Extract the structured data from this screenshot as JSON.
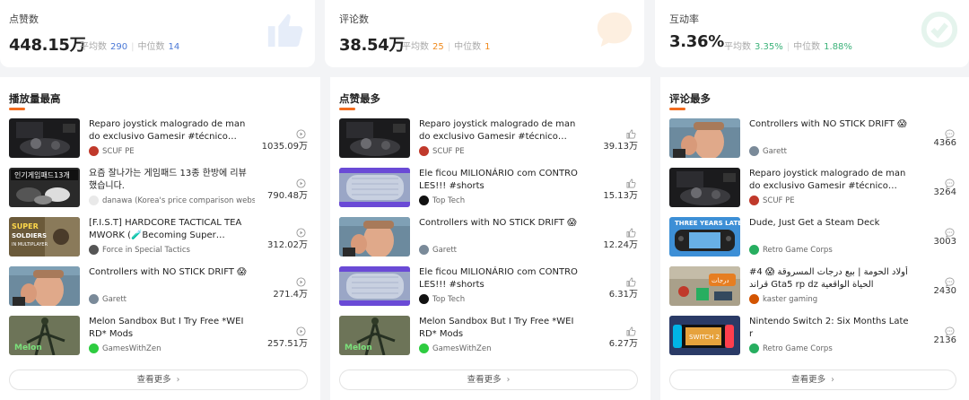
{
  "stats": [
    {
      "title": "点赞数",
      "value": "448.15万",
      "avg_label": "平均数",
      "avg": "290",
      "median_label": "中位数",
      "median": "14",
      "color": "#4a78d6",
      "icon": "thumbs-up-icon"
    },
    {
      "title": "评论数",
      "value": "38.54万",
      "avg_label": "平均数",
      "avg": "25",
      "median_label": "中位数",
      "median": "1",
      "color": "#f08a1c",
      "icon": "chat-bubble-icon"
    },
    {
      "title": "互动率",
      "value": "3.36%",
      "avg_label": "平均数",
      "avg": "3.35%",
      "median_label": "中位数",
      "median": "1.88%",
      "color": "#3cb27a",
      "icon": "interaction-icon"
    }
  ],
  "panels": [
    {
      "title": "播放量最高",
      "metric_icon": "play-icon",
      "more": "查看更多",
      "items": [
        {
          "title": "Reparo joystick malogrado de mando exclusivo Gamesir #técnico…",
          "author": "SCUF PE",
          "value": "1035.09万",
          "avatar_color": "#c0392b",
          "thumb": "dark-room"
        },
        {
          "title": "요즘 잘나가는 게임패드 13종 한방에 리뷰했습니다.",
          "author": "danawa (Korea's price comparison webs…",
          "value": "790.48万",
          "avatar_color": "#e9e9e9",
          "thumb": "korean-review"
        },
        {
          "title": "[F.I.S.T] HARDCORE TACTICAL TEAMWORK (🧪Becoming Super…",
          "author": "Force in Special Tactics",
          "value": "312.02万",
          "avatar_color": "#555555",
          "thumb": "super-soldiers"
        },
        {
          "title": "Controllers with NO STICK DRIFT 😱",
          "author": "Garett",
          "value": "271.4万",
          "avatar_color": "#7a8a99",
          "thumb": "face"
        },
        {
          "title": "Melon Sandbox But I Try Free *WEIRD* Mods",
          "author": "GamesWithZen",
          "value": "257.51万",
          "avatar_color": "#2ecc40",
          "thumb": "melon"
        }
      ]
    },
    {
      "title": "点赞最多",
      "metric_icon": "thumbs-up-icon",
      "more": "查看更多",
      "items": [
        {
          "title": "Reparo joystick malogrado de mando exclusivo Gamesir #técnico…",
          "author": "SCUF PE",
          "value": "39.13万",
          "avatar_color": "#c0392b",
          "thumb": "dark-room"
        },
        {
          "title": "Ele ficou MILIONÁRIO com CONTROLES!!! #shorts",
          "author": "Top Tech",
          "value": "15.13万",
          "avatar_color": "#111111",
          "thumb": "cylinder"
        },
        {
          "title": "Controllers with NO STICK DRIFT 😱",
          "author": "Garett",
          "value": "12.24万",
          "avatar_color": "#7a8a99",
          "thumb": "face"
        },
        {
          "title": "Ele ficou MILIONÁRIO com CONTROLES!!! #shorts",
          "author": "Top Tech",
          "value": "6.31万",
          "avatar_color": "#111111",
          "thumb": "cylinder"
        },
        {
          "title": "Melon Sandbox But I Try Free *WEIRD* Mods",
          "author": "GamesWithZen",
          "value": "6.27万",
          "avatar_color": "#2ecc40",
          "thumb": "melon"
        }
      ]
    },
    {
      "title": "评论最多",
      "metric_icon": "comment-icon",
      "more": "查看更多",
      "items": [
        {
          "title": "Controllers with NO STICK DRIFT 😱",
          "author": "Garett",
          "value": "4366",
          "avatar_color": "#7a8a99",
          "thumb": "face"
        },
        {
          "title": "Reparo joystick malogrado de mando exclusivo Gamesir #técnico…",
          "author": "SCUF PE",
          "value": "3264",
          "avatar_color": "#c0392b",
          "thumb": "dark-room"
        },
        {
          "title": "Dude, Just Get a Steam Deck",
          "author": "Retro Game Corps",
          "value": "3003",
          "avatar_color": "#27ae60",
          "thumb": "steam-deck"
        },
        {
          "title": "#4 أولاد الحومة | بيع درجات المسروقة 😱 قراند Gta5 rp dz الحياة الواقعية",
          "author": "kaster gaming",
          "value": "2430",
          "avatar_color": "#d35400",
          "thumb": "gta"
        },
        {
          "title": "Nintendo Switch 2: Six Months Later",
          "author": "Retro Game Corps",
          "value": "2136",
          "avatar_color": "#27ae60",
          "thumb": "switch"
        }
      ]
    }
  ]
}
